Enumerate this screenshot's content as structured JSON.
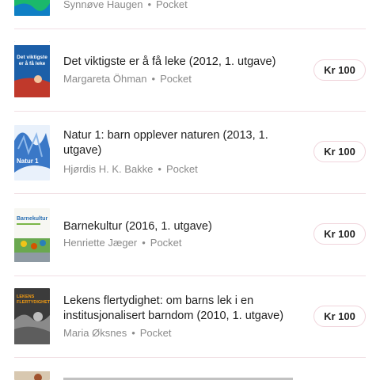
{
  "items": [
    {
      "title": "",
      "author": "Synnøve Haugen",
      "format": "Pocket",
      "price": "",
      "cover_text": ""
    },
    {
      "title": "Det viktigste er å få leke (2012, 1. utgave)",
      "author": "Margareta Öhman",
      "format": "Pocket",
      "price": "Kr 100",
      "cover_text": "Det viktigste er å få leke"
    },
    {
      "title": "Natur 1: barn opplever naturen (2013, 1. utgave)",
      "author": "Hjørdis H. K. Bakke",
      "format": "Pocket",
      "price": "Kr 100",
      "cover_text": "Natur 1"
    },
    {
      "title": "Barnekultur (2016, 1. utgave)",
      "author": "Henriette Jæger",
      "format": "Pocket",
      "price": "Kr 100",
      "cover_text": "Barnekultur"
    },
    {
      "title": "Lekens flertydighet: om barns lek i en institusjonalisert barndom (2010, 1. utgave)",
      "author": "Maria Øksnes",
      "format": "Pocket",
      "price": "Kr 100",
      "cover_text": "LEKENS FLERTYDIGHET"
    }
  ],
  "separator": "•",
  "colors": {
    "divider": "#f1dfe4",
    "price_border": "#f0d5dc",
    "meta_text": "#8a8a8a"
  }
}
